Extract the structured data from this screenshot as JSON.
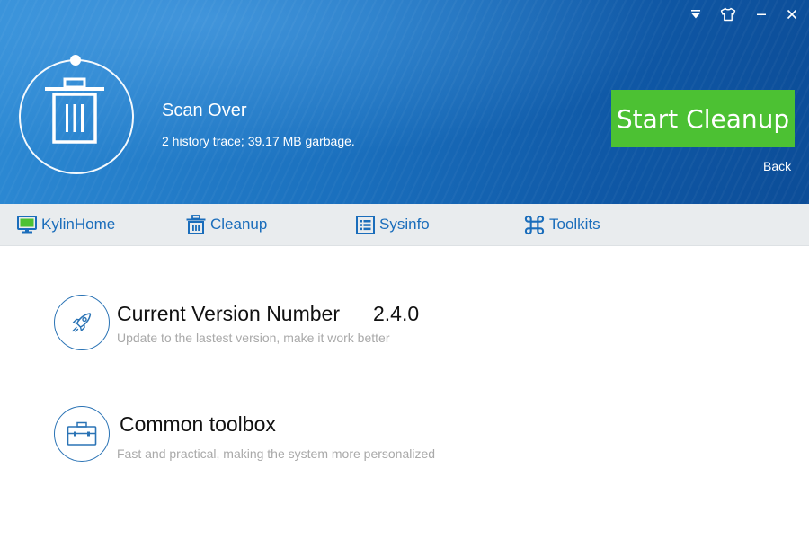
{
  "window_controls": {
    "menu_icon": "dropdown-arrow-icon",
    "skin_icon": "tshirt-icon",
    "minimize_icon": "minimize-icon",
    "close_icon": "close-icon"
  },
  "header": {
    "status_icon": "trash-can-icon",
    "title": "Scan Over",
    "summary": "2 history trace; 39.17 MB garbage.",
    "start_button_label": "Start Cleanup",
    "back_label": "Back",
    "colors": {
      "background": "#1a6fbd",
      "start_button": "#4cc133"
    }
  },
  "nav": {
    "items": [
      {
        "label": "KylinHome",
        "icon": "monitor-icon"
      },
      {
        "label": "Cleanup",
        "icon": "trash-icon"
      },
      {
        "label": "Sysinfo",
        "icon": "list-icon"
      },
      {
        "label": "Toolkits",
        "icon": "command-icon"
      }
    ],
    "color": "#1a6dbb"
  },
  "features": [
    {
      "icon": "rocket-icon",
      "title": "Current Version Number",
      "value": "2.4.0",
      "description": "Update to the lastest version, make it work better"
    },
    {
      "icon": "toolbox-icon",
      "title": "Common toolbox",
      "description": "Fast and practical, making the system more personalized"
    }
  ]
}
